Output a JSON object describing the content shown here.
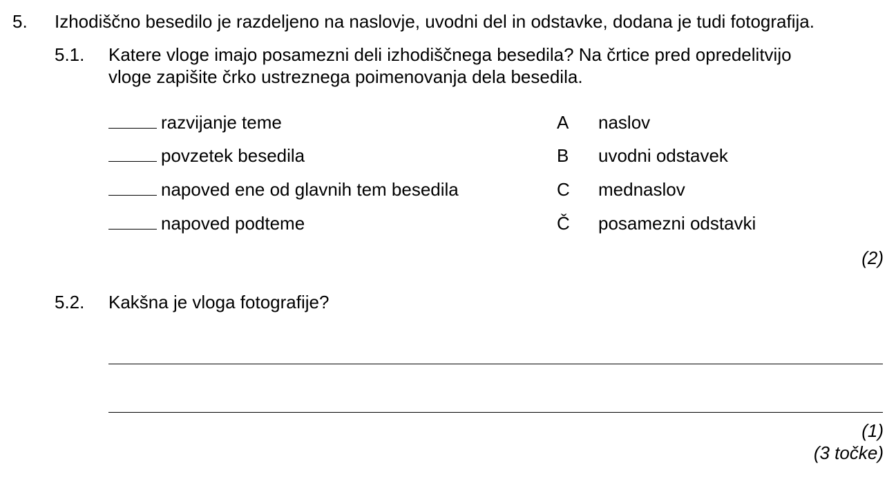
{
  "question": {
    "number": "5.",
    "text": "Izhodiščno besedilo je razdeljeno na naslovje, uvodni del in odstavke, dodana je tudi fotografija."
  },
  "sub1": {
    "number": "5.1.",
    "text_line1": "Katere vloge imajo posamezni deli izhodiščnega besedila? Na črtice pred opredelitvijo",
    "text_line2": "vloge zapišite črko ustreznega poimenovanja dela besedila.",
    "roles": [
      "razvijanje teme",
      "povzetek besedila",
      "napoved ene od glavnih tem besedila",
      "napoved podteme"
    ],
    "options": [
      {
        "letter": "A",
        "label": "naslov"
      },
      {
        "letter": "B",
        "label": "uvodni odstavek"
      },
      {
        "letter": "C",
        "label": "mednaslov"
      },
      {
        "letter": "Č",
        "label": "posamezni odstavki"
      }
    ],
    "points": "(2)"
  },
  "sub2": {
    "number": "5.2.",
    "text": "Kakšna je vloga fotografije?",
    "points": "(1)"
  },
  "total": "(3 točke)"
}
